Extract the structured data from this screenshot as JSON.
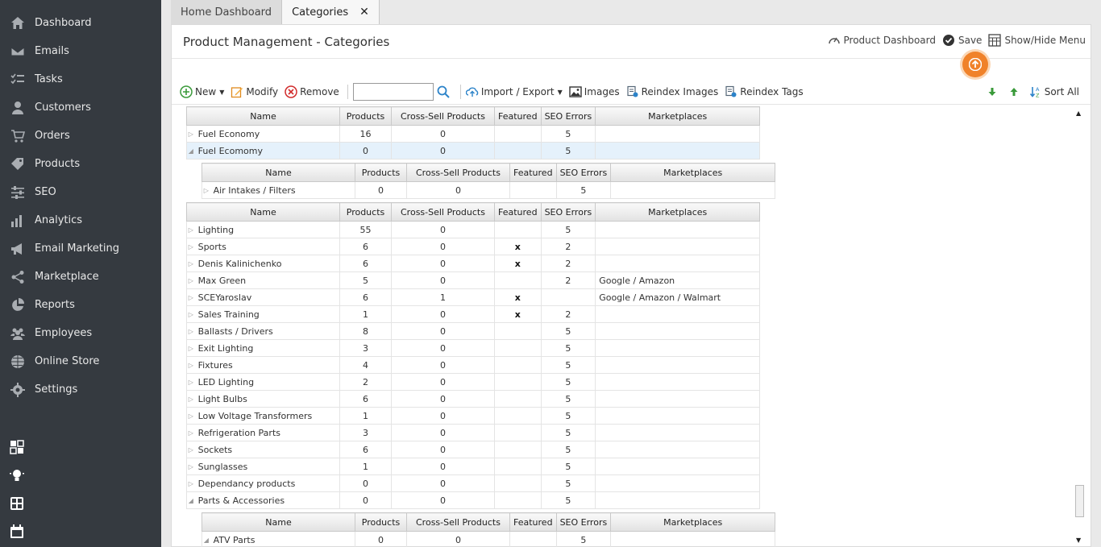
{
  "sidebar": {
    "items": [
      {
        "label": "Dashboard",
        "icon": "home-icon"
      },
      {
        "label": "Emails",
        "icon": "envelope-icon"
      },
      {
        "label": "Tasks",
        "icon": "tasks-icon"
      },
      {
        "label": "Customers",
        "icon": "user-icon"
      },
      {
        "label": "Orders",
        "icon": "cart-icon"
      },
      {
        "label": "Products",
        "icon": "tag-icon"
      },
      {
        "label": "SEO",
        "icon": "sliders-icon"
      },
      {
        "label": "Analytics",
        "icon": "bar-chart-icon"
      },
      {
        "label": "Email Marketing",
        "icon": "megaphone-icon"
      },
      {
        "label": "Marketplace",
        "icon": "share-icon"
      },
      {
        "label": "Reports",
        "icon": "pie-chart-icon"
      },
      {
        "label": "Employees",
        "icon": "group-icon"
      },
      {
        "label": "Online Store",
        "icon": "globe-icon"
      },
      {
        "label": "Settings",
        "icon": "gear-icon"
      }
    ],
    "bottom_icons": [
      "windows-icon",
      "lightbulb-icon",
      "calculator-icon",
      "calendar-icon"
    ]
  },
  "tabs": [
    {
      "label": "Home Dashboard",
      "active": false
    },
    {
      "label": "Categories",
      "active": true,
      "close": "✕"
    }
  ],
  "header": {
    "title": "Product Management - Categories",
    "actions": {
      "product_dashboard": "Product Dashboard",
      "save": "Save",
      "show_hide_menu": "Show/Hide Menu"
    }
  },
  "toolbar": {
    "new": "New",
    "modify": "Modify",
    "remove": "Remove",
    "search_value": "",
    "import_export": "Import / Export",
    "images": "Images",
    "reindex_images": "Reindex Images",
    "reindex_tags": "Reindex Tags",
    "sort_all": "Sort All"
  },
  "columns": [
    "Name",
    "Products",
    "Cross-Sell Products",
    "Featured",
    "SEO Errors",
    "Marketplaces"
  ],
  "grid_top": {
    "rows": [
      {
        "name": "Fuel Economy",
        "products": "16",
        "cross": "0",
        "featured": "",
        "seo": "5",
        "market": "",
        "exp": "▷"
      },
      {
        "name": "Fuel Ecomomy",
        "products": "0",
        "cross": "0",
        "featured": "",
        "seo": "5",
        "market": "",
        "exp": "◢"
      }
    ]
  },
  "subgrid_1": {
    "rows": [
      {
        "name": "Air Intakes / Filters",
        "products": "0",
        "cross": "0",
        "featured": "",
        "seo": "5",
        "market": "",
        "exp": "▷"
      }
    ]
  },
  "grid_main": {
    "rows": [
      {
        "name": "Lighting",
        "products": "55",
        "cross": "0",
        "featured": "",
        "seo": "5",
        "market": "",
        "exp": "▷"
      },
      {
        "name": "Sports",
        "products": "6",
        "cross": "0",
        "featured": "x",
        "seo": "2",
        "market": "",
        "exp": "▷"
      },
      {
        "name": "Denis Kalinichenko",
        "products": "6",
        "cross": "0",
        "featured": "x",
        "seo": "2",
        "market": "",
        "exp": "▷"
      },
      {
        "name": "Max Green",
        "products": "5",
        "cross": "0",
        "featured": "",
        "seo": "2",
        "market": "Google / Amazon",
        "exp": "▷"
      },
      {
        "name": "SCEYaroslav",
        "products": "6",
        "cross": "1",
        "featured": "x",
        "seo": "",
        "market": "Google / Amazon / Walmart",
        "exp": "▷"
      },
      {
        "name": "Sales Training",
        "products": "1",
        "cross": "0",
        "featured": "x",
        "seo": "2",
        "market": "",
        "exp": "▷"
      },
      {
        "name": "Ballasts / Drivers",
        "products": "8",
        "cross": "0",
        "featured": "",
        "seo": "5",
        "market": "",
        "exp": "▷"
      },
      {
        "name": "Exit Lighting",
        "products": "3",
        "cross": "0",
        "featured": "",
        "seo": "5",
        "market": "",
        "exp": "▷"
      },
      {
        "name": "Fixtures",
        "products": "4",
        "cross": "0",
        "featured": "",
        "seo": "5",
        "market": "",
        "exp": "▷"
      },
      {
        "name": "LED Lighting",
        "products": "2",
        "cross": "0",
        "featured": "",
        "seo": "5",
        "market": "",
        "exp": "▷"
      },
      {
        "name": "Light Bulbs",
        "products": "6",
        "cross": "0",
        "featured": "",
        "seo": "5",
        "market": "",
        "exp": "▷"
      },
      {
        "name": "Low Voltage Transformers",
        "products": "1",
        "cross": "0",
        "featured": "",
        "seo": "5",
        "market": "",
        "exp": "▷"
      },
      {
        "name": "Refrigeration Parts",
        "products": "3",
        "cross": "0",
        "featured": "",
        "seo": "5",
        "market": "",
        "exp": "▷"
      },
      {
        "name": "Sockets",
        "products": "6",
        "cross": "0",
        "featured": "",
        "seo": "5",
        "market": "",
        "exp": "▷"
      },
      {
        "name": "Sunglasses",
        "products": "1",
        "cross": "0",
        "featured": "",
        "seo": "5",
        "market": "",
        "exp": "▷"
      },
      {
        "name": "Dependancy products",
        "products": "0",
        "cross": "0",
        "featured": "",
        "seo": "5",
        "market": "",
        "exp": "▷"
      },
      {
        "name": "Parts & Accessories",
        "products": "0",
        "cross": "0",
        "featured": "",
        "seo": "5",
        "market": "",
        "exp": "◢"
      }
    ]
  },
  "subgrid_2": {
    "rows": [
      {
        "name": "ATV Parts",
        "products": "0",
        "cross": "0",
        "featured": "",
        "seo": "5",
        "market": "",
        "exp": "◢"
      }
    ]
  },
  "colors": {
    "sidebar_bg": "#353a40",
    "accent_orange": "#f0822a",
    "selected_row": "#e5f1fb"
  }
}
